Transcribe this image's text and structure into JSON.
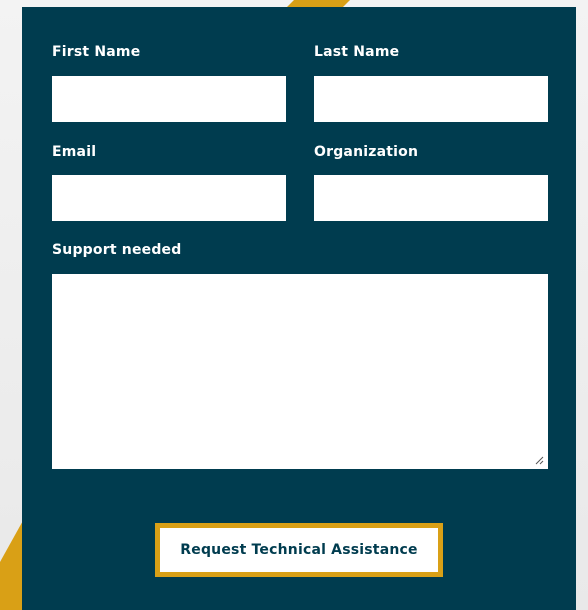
{
  "form": {
    "first_name": {
      "label": "First Name",
      "value": "",
      "placeholder": ""
    },
    "last_name": {
      "label": "Last Name",
      "value": "",
      "placeholder": ""
    },
    "email": {
      "label": "Email",
      "value": "",
      "placeholder": ""
    },
    "organization": {
      "label": "Organization",
      "value": "",
      "placeholder": ""
    },
    "support_needed": {
      "label": "Support needed",
      "value": "",
      "placeholder": ""
    },
    "submit_label": "Request Technical Assistance"
  },
  "colors": {
    "panel": "#003c4f",
    "accent": "#d9a016",
    "field": "#ffffff",
    "label_text": "#ffffff"
  },
  "icons": {
    "textarea_resize": "resize-grip-icon"
  }
}
